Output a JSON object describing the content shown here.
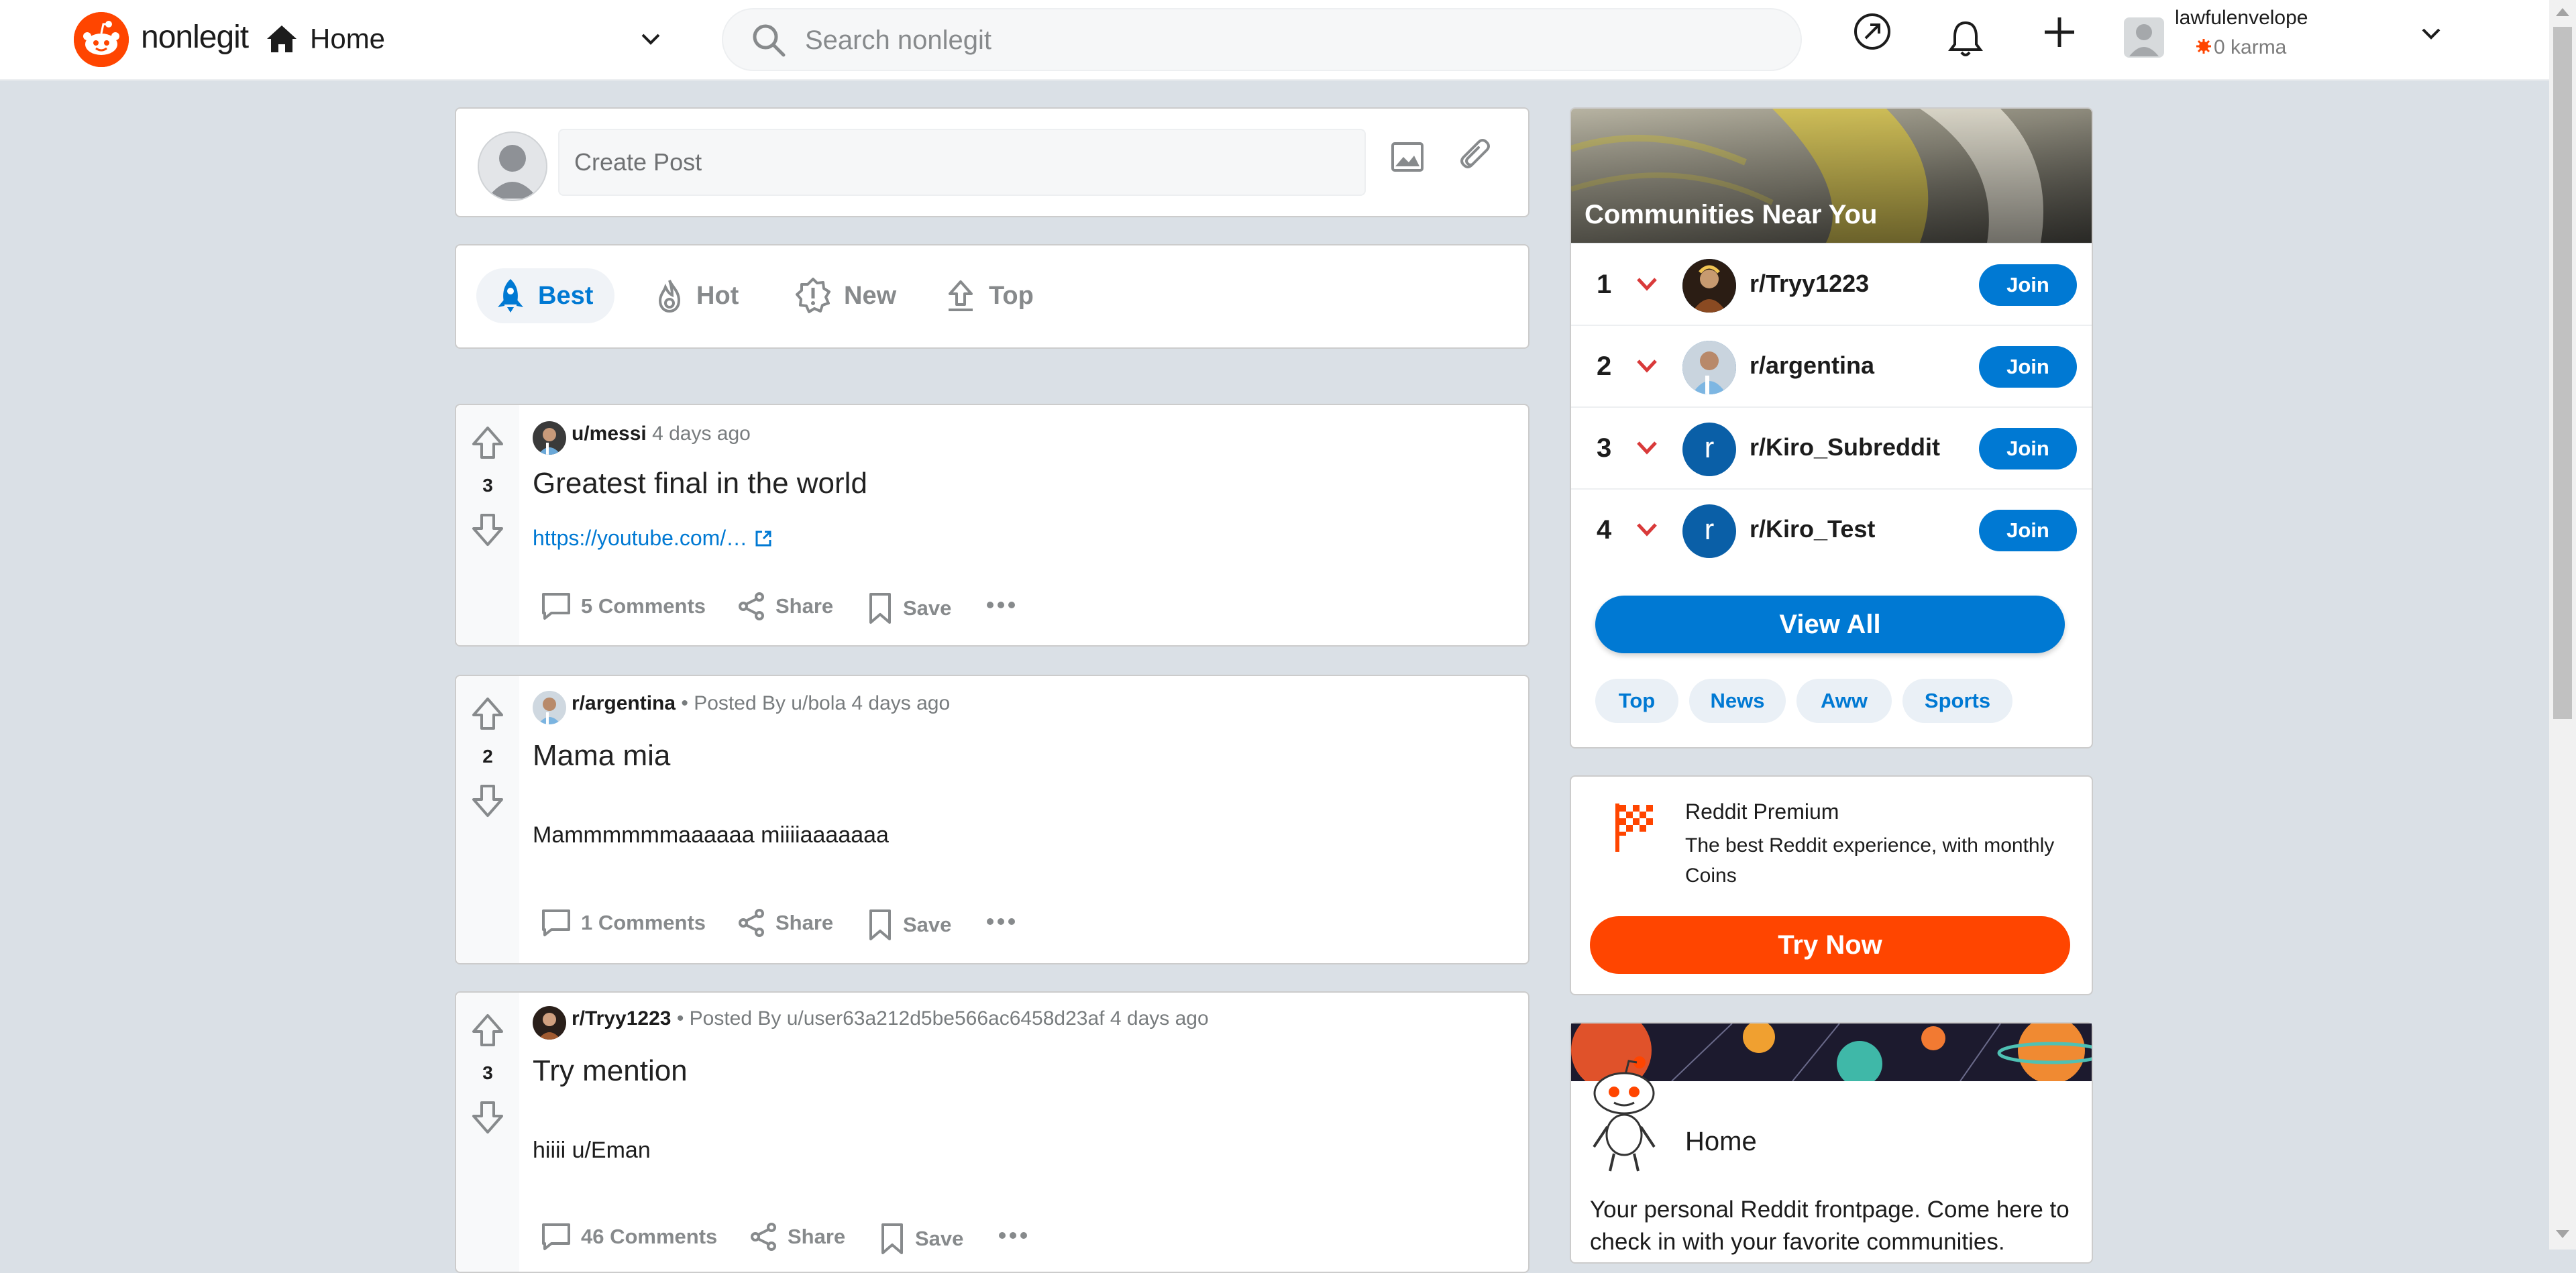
{
  "header": {
    "logo_text": "nonlegit",
    "feed_label": "Home",
    "search_placeholder": "Search nonlegit",
    "username": "lawfulenvelope",
    "karma": "0 karma"
  },
  "create_post": {
    "placeholder": "Create Post"
  },
  "sort_tabs": [
    {
      "label": "Best",
      "icon": "rocket-icon",
      "active": true
    },
    {
      "label": "Hot",
      "icon": "flame-icon"
    },
    {
      "label": "New",
      "icon": "new-badge-icon"
    },
    {
      "label": "Top",
      "icon": "top-upload-icon"
    }
  ],
  "posts": [
    {
      "score": "3",
      "subreddit": "",
      "author": "u/messi",
      "posted_by": "",
      "time": "4 days ago",
      "title": "Greatest final in the world",
      "link": "https://youtube.com/…",
      "body": "",
      "comments": "5 Comments",
      "share": "Share",
      "save": "Save"
    },
    {
      "score": "2",
      "subreddit": "r/argentina",
      "posted_by": "• Posted By u/bola",
      "time": "4 days ago",
      "title": "Mama mia",
      "body": "Mammmmmmaaaaaa miiiiaaaaaaa",
      "comments": "1 Comments",
      "share": "Share",
      "save": "Save"
    },
    {
      "score": "3",
      "subreddit": "r/Tryy1223",
      "posted_by": "• Posted By u/user63a212d5be566ac6458d23af",
      "time": "4 days ago",
      "title": "Try mention",
      "body": "hiiii u/Eman",
      "comments": "46 Comments",
      "share": "Share",
      "save": "Save"
    }
  ],
  "communities": {
    "title": "Communities Near You",
    "items": [
      {
        "rank": "1",
        "name": "r/Tryy1223",
        "avatar_letter": "",
        "join": "Join"
      },
      {
        "rank": "2",
        "name": "r/argentina",
        "avatar_letter": "",
        "join": "Join"
      },
      {
        "rank": "3",
        "name": "r/Kiro_Subreddit",
        "avatar_letter": "r",
        "join": "Join"
      },
      {
        "rank": "4",
        "name": "r/Kiro_Test",
        "avatar_letter": "r",
        "join": "Join"
      }
    ],
    "view_all": "View All",
    "chips": [
      "Top",
      "News",
      "Aww",
      "Sports"
    ]
  },
  "premium": {
    "title": "Reddit Premium",
    "description": "The best Reddit experience, with monthly Coins",
    "button": "Try Now"
  },
  "home_card": {
    "title": "Home",
    "description": "Your personal Reddit frontpage. Come here to check in with your favorite communities."
  },
  "colors": {
    "accent_blue": "#0079d3",
    "brand_orange": "#ff4500",
    "page_bg": "#dae0e6",
    "downvote_red": "#d93a3a"
  }
}
